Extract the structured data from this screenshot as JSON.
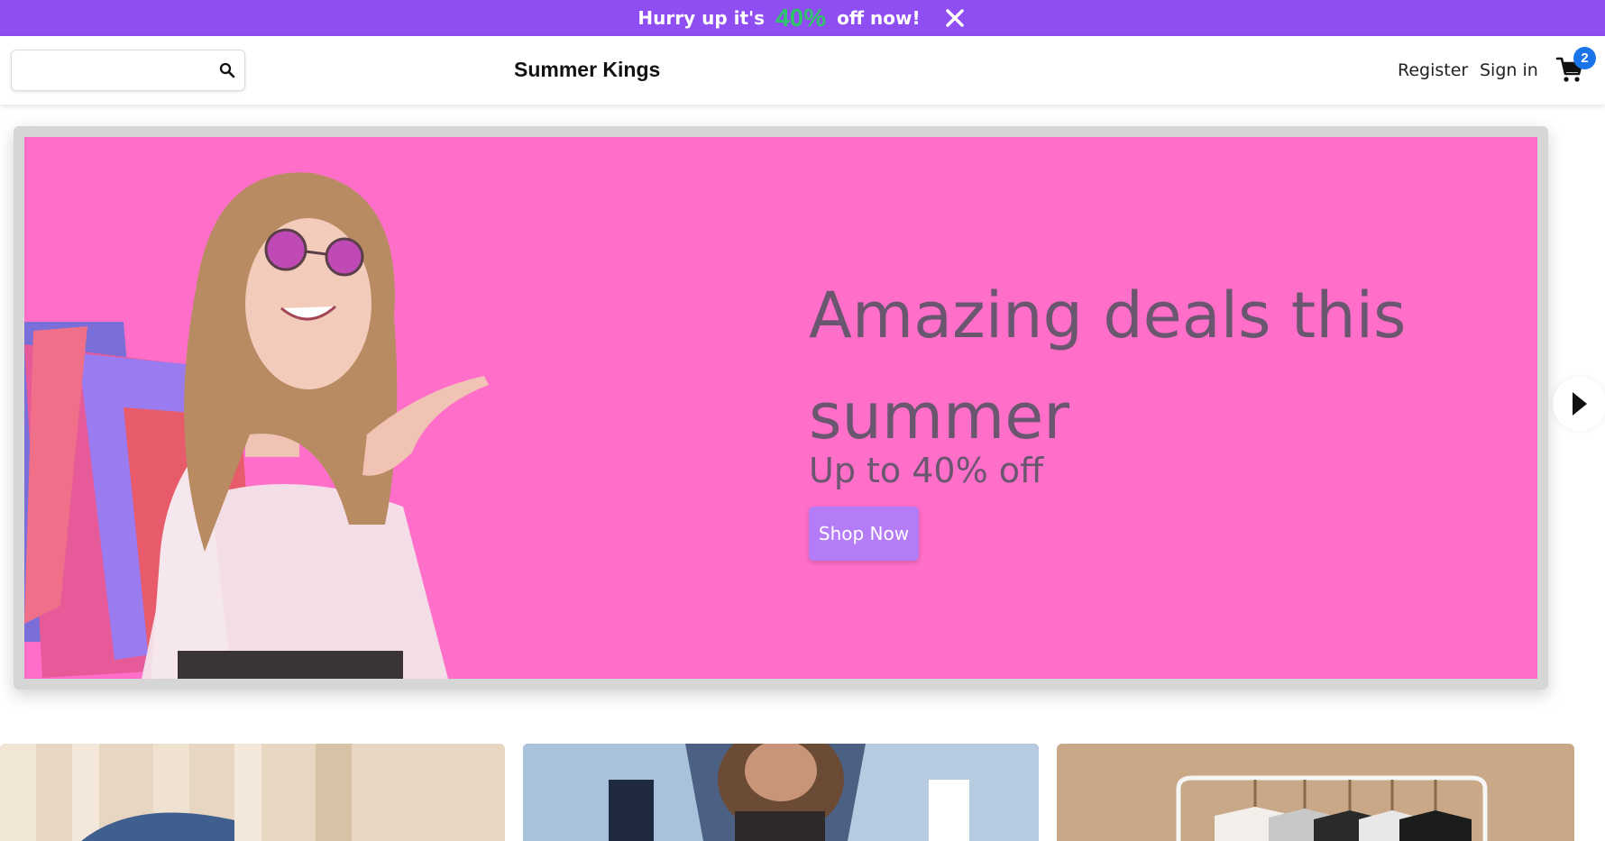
{
  "promo": {
    "prefix": "Hurry up it's",
    "percent": "40%",
    "suffix": "off now!",
    "close_icon": "close-icon"
  },
  "header": {
    "search": {
      "value": "",
      "placeholder": "",
      "icon": "search-icon"
    },
    "brand": "Summer Kings",
    "register": "Register",
    "sign_in": "Sign in",
    "cart": {
      "icon": "cart-icon",
      "count": "2"
    }
  },
  "hero": {
    "headline": "Amazing deals this summer",
    "subline": "Up to 40% off",
    "cta": "Shop Now",
    "background": "#ff6fc9",
    "next_icon": "chevron-right-icon"
  },
  "categories": [
    {
      "image": "denim-photo"
    },
    {
      "image": "denim-jackets-photo"
    },
    {
      "image": "clothes-rack-photo"
    }
  ],
  "colors": {
    "promo_bg": "#8e4ef2",
    "promo_accent": "#2fc46b",
    "badge": "#1a73e8",
    "button": "#b57cf8"
  }
}
